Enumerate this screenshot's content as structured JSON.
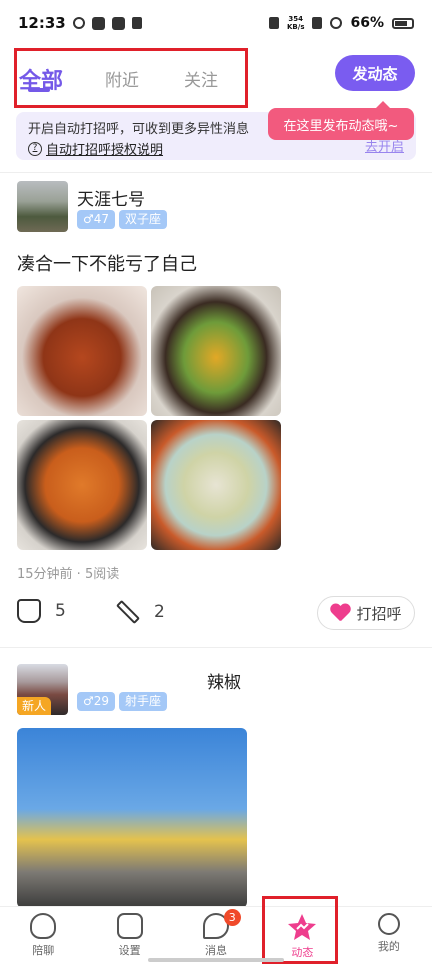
{
  "status_bar": {
    "time": "12:33",
    "net_speed_value": "354",
    "net_speed_unit": "KB/s",
    "battery": "66%"
  },
  "top_tabs": {
    "items": [
      {
        "label": "全部",
        "active": true
      },
      {
        "label": "附近",
        "active": false
      },
      {
        "label": "关注",
        "active": false
      }
    ]
  },
  "post_button": {
    "label": "发动态"
  },
  "tooltip": {
    "text": "在这里发布动态哦~"
  },
  "notice": {
    "text": "开启自动打招呼，可收到更多异性消息",
    "help_link": "自动打招呼授权说明",
    "action_link": "去开启"
  },
  "posts": [
    {
      "username": "天涯七号",
      "gender_age": "♂47",
      "zodiac": "双子座",
      "text": "凑合一下不能亏了自己",
      "meta": "15分钟前 · 5阅读",
      "likes": "5",
      "comments": "2",
      "greet_label": "打招呼"
    },
    {
      "username": "辣椒",
      "gender_age": "♂29",
      "zodiac": "射手座",
      "new_label": "新人"
    }
  ],
  "bottom_nav": {
    "items": [
      {
        "label": "陪聊",
        "icon": "heart-rate-icon"
      },
      {
        "label": "设置",
        "icon": "settings-hex-icon"
      },
      {
        "label": "消息",
        "icon": "chat-icon",
        "badge": "3"
      },
      {
        "label": "动态",
        "icon": "star-icon",
        "active": true
      },
      {
        "label": "我的",
        "icon": "user-icon"
      }
    ]
  },
  "colors": {
    "accent": "#7459e8",
    "pink": "#ee3d8d",
    "highlight_box": "#e0202a",
    "tag_blue": "#a4c8f7",
    "badge_red": "#f04a2a"
  }
}
